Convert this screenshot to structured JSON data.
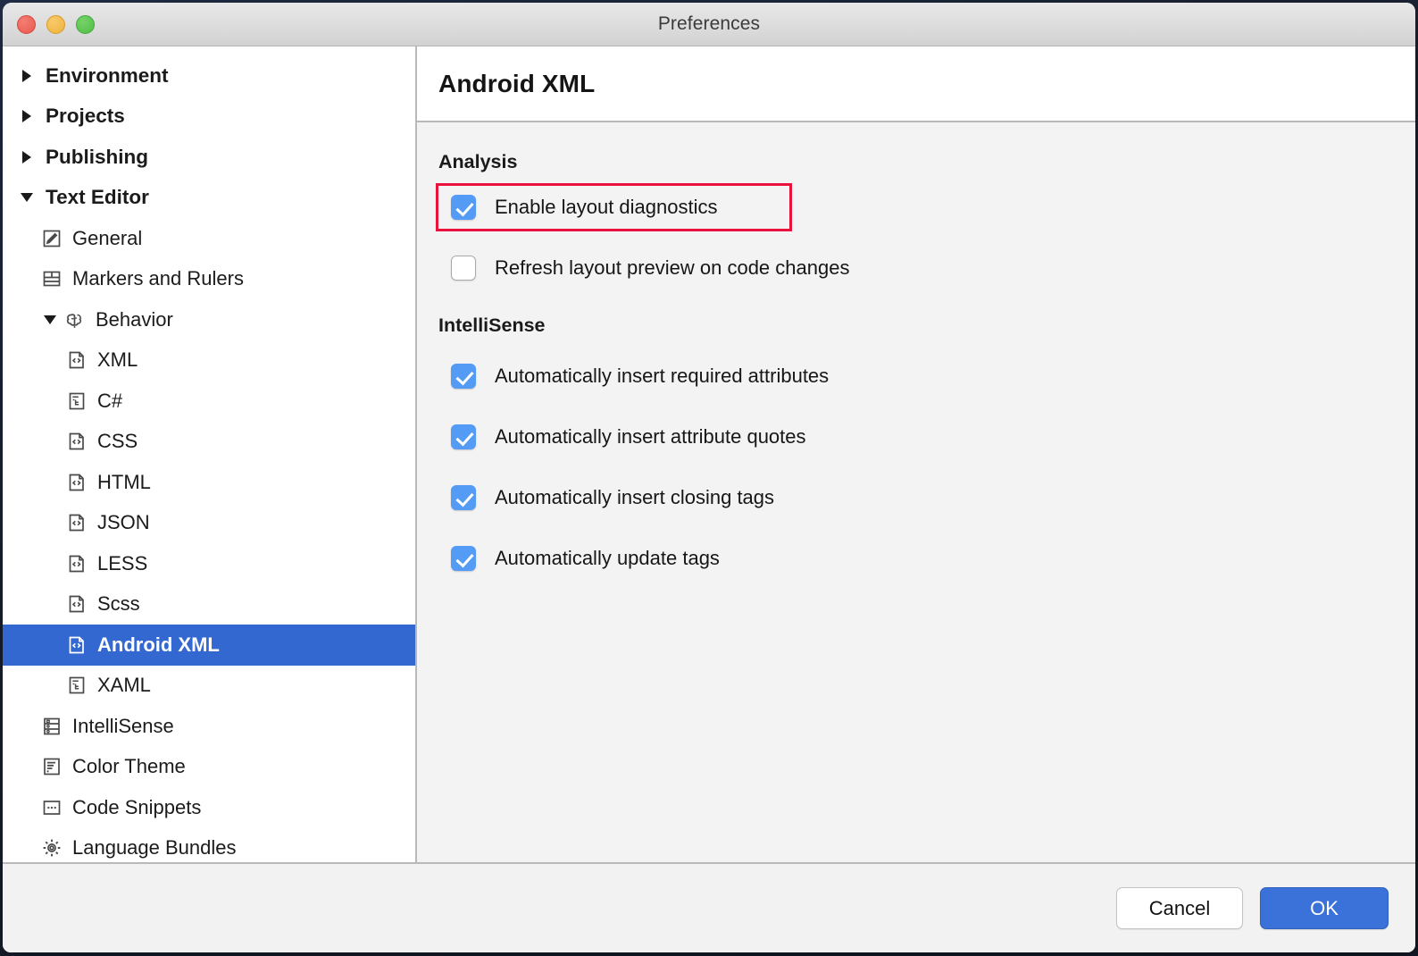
{
  "window": {
    "title": "Preferences",
    "traffic_lights": [
      {
        "name": "close",
        "color": "#e9574c"
      },
      {
        "name": "minimize",
        "color": "#f0b23c"
      },
      {
        "name": "maximize",
        "color": "#4fbf45"
      }
    ]
  },
  "sidebar": {
    "items": [
      {
        "label": "Environment",
        "icon": "disclosure-triangle-right",
        "indent": 0,
        "expanded": false,
        "selected": false,
        "top": true
      },
      {
        "label": "Projects",
        "icon": "disclosure-triangle-right",
        "indent": 0,
        "expanded": false,
        "selected": false,
        "top": true
      },
      {
        "label": "Publishing",
        "icon": "disclosure-triangle-right",
        "indent": 0,
        "expanded": false,
        "selected": false,
        "top": true
      },
      {
        "label": "Text Editor",
        "icon": "disclosure-triangle-down",
        "indent": 0,
        "expanded": true,
        "selected": false,
        "top": true
      },
      {
        "label": "General",
        "icon": "pencil-square-icon",
        "indent": 1,
        "selected": false
      },
      {
        "label": "Markers and Rulers",
        "icon": "table-grid-icon",
        "indent": 1,
        "selected": false
      },
      {
        "label": "Behavior",
        "icon": "brain-icon",
        "indent": 1,
        "expanded": true,
        "selected": false
      },
      {
        "label": "XML",
        "icon": "code-file-icon",
        "indent": 2,
        "selected": false
      },
      {
        "label": "C#",
        "icon": "markup-file-icon",
        "indent": 2,
        "selected": false
      },
      {
        "label": "CSS",
        "icon": "code-file-icon",
        "indent": 2,
        "selected": false
      },
      {
        "label": "HTML",
        "icon": "code-file-icon",
        "indent": 2,
        "selected": false
      },
      {
        "label": "JSON",
        "icon": "code-file-icon",
        "indent": 2,
        "selected": false
      },
      {
        "label": "LESS",
        "icon": "code-file-icon",
        "indent": 2,
        "selected": false
      },
      {
        "label": "Scss",
        "icon": "code-file-icon",
        "indent": 2,
        "selected": false
      },
      {
        "label": "Android XML",
        "icon": "code-file-icon",
        "indent": 2,
        "selected": true
      },
      {
        "label": "XAML",
        "icon": "markup-file-icon",
        "indent": 2,
        "selected": false
      },
      {
        "label": "IntelliSense",
        "icon": "list-rows-icon",
        "indent": 1,
        "selected": false
      },
      {
        "label": "Color Theme",
        "icon": "text-lines-icon",
        "indent": 1,
        "selected": false
      },
      {
        "label": "Code Snippets",
        "icon": "ellipsis-box-icon",
        "indent": 1,
        "selected": false
      },
      {
        "label": "Language Bundles",
        "icon": "gear-icon",
        "indent": 1,
        "selected": false
      }
    ],
    "selection_color": "#3468d1"
  },
  "content": {
    "page_title": "Android XML",
    "groups": [
      {
        "title": "Analysis",
        "options": [
          {
            "label": "Enable layout diagnostics",
            "checked": true,
            "highlighted": true
          },
          {
            "label": "Refresh layout preview on code changes",
            "checked": false,
            "highlighted": false
          }
        ]
      },
      {
        "title": "IntelliSense",
        "options": [
          {
            "label": "Automatically insert required attributes",
            "checked": true,
            "highlighted": false
          },
          {
            "label": "Automatically insert attribute quotes",
            "checked": true,
            "highlighted": false
          },
          {
            "label": "Automatically insert closing tags",
            "checked": true,
            "highlighted": false
          },
          {
            "label": "Automatically update tags",
            "checked": true,
            "highlighted": false
          }
        ]
      }
    ],
    "highlight_color": "#e8123c",
    "checkbox_on_color": "#549bf5"
  },
  "footer": {
    "cancel_label": "Cancel",
    "ok_label": "OK",
    "ok_color": "#3b72d9"
  }
}
